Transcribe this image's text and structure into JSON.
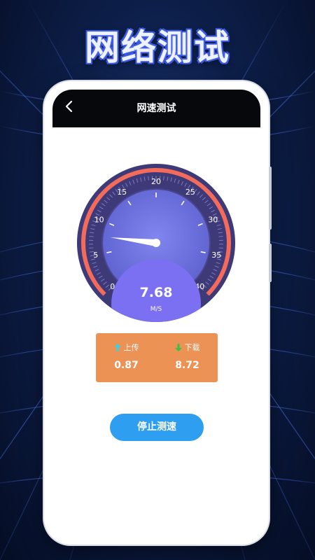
{
  "promo": {
    "title": "网络测试"
  },
  "app": {
    "title": "网速测试"
  },
  "gauge": {
    "value": "7.68",
    "unit": "M/S",
    "speed_value": 7.68,
    "scale_min": 0,
    "scale_max": 40,
    "ticks": [
      "0",
      "5",
      "10",
      "15",
      "20",
      "25",
      "30",
      "35",
      "40"
    ]
  },
  "stats": {
    "upload": {
      "label": "上传",
      "value": "0.87"
    },
    "download": {
      "label": "下载",
      "value": "8.72"
    }
  },
  "actions": {
    "stop_label": "停止测速"
  },
  "colors": {
    "gauge_ring": "#3e3a78",
    "gauge_face": "#6a6fda",
    "arc": "#f26b5b",
    "readout": "#7b6ff2",
    "stats_bg": "#ec9255",
    "upload_arrow": "#3ad1e3",
    "download_arrow": "#37c04a",
    "button": "#2e9ef0"
  },
  "icons": {
    "back": "chevron-left-icon",
    "upload": "arrow-up-icon",
    "download": "arrow-down-icon"
  }
}
